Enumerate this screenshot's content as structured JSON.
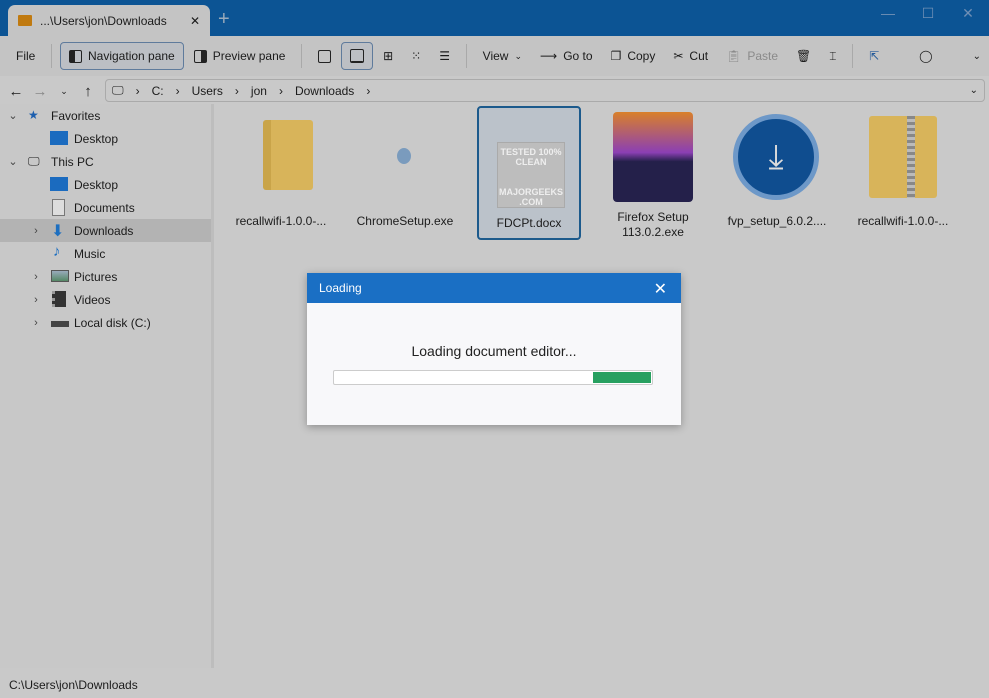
{
  "window": {
    "tab_title": "...\\Users\\jon\\Downloads",
    "new_tab": "+",
    "close_tab": "✕",
    "minimize": "—",
    "maximize": "☐",
    "close": "✕"
  },
  "toolbar": {
    "file": "File",
    "navigation_pane": "Navigation pane",
    "preview_pane": "Preview pane",
    "view": "View",
    "goto": "Go to",
    "copy": "Copy",
    "cut": "Cut",
    "paste": "Paste"
  },
  "address": {
    "segments": [
      "C:",
      "Users",
      "jon",
      "Downloads"
    ]
  },
  "sidebar": {
    "items": [
      {
        "label": "Favorites"
      },
      {
        "label": "Desktop"
      },
      {
        "label": "This PC"
      },
      {
        "label": "Desktop"
      },
      {
        "label": "Documents"
      },
      {
        "label": "Downloads"
      },
      {
        "label": "Music"
      },
      {
        "label": "Pictures"
      },
      {
        "label": "Videos"
      },
      {
        "label": "Local disk (C:)"
      }
    ]
  },
  "files": [
    {
      "name": "recallwifi-1.0.0-..."
    },
    {
      "name": "ChromeSetup.exe"
    },
    {
      "name": "FDCPt.docx"
    },
    {
      "name": "Firefox Setup 113.0.2.exe"
    },
    {
      "name": "fvp_setup_6.0.2...."
    },
    {
      "name": "recallwifi-1.0.0-..."
    }
  ],
  "watermark": "TESTED 100% CLEAN MAJORGEEKS .COM",
  "status": "C:\\Users\\jon\\Downloads",
  "dialog": {
    "title": "Loading",
    "message": "Loading document editor...",
    "close": "✕"
  },
  "colors": {
    "titlebar": "#0c5494",
    "dialog_header": "#1a6fc4",
    "progress": "#27a060"
  }
}
